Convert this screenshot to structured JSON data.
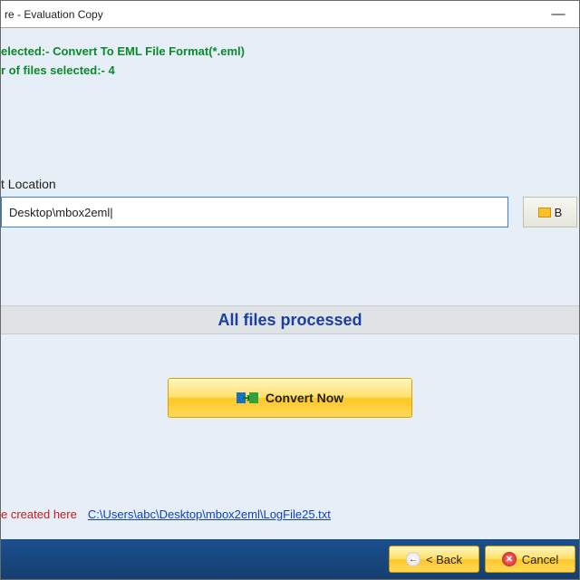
{
  "titlebar": {
    "title": "re - Evaluation Copy"
  },
  "info": {
    "format_line": "elected:- Convert To EML File Format(*.eml)",
    "files_line": "r of files selected:- 4"
  },
  "target": {
    "label": "t Location",
    "path_value": "Desktop\\mbox2eml|",
    "browse_label": "B"
  },
  "status": {
    "text": "All files processed"
  },
  "convert": {
    "label": "Convert Now"
  },
  "log": {
    "label": "e created here",
    "link": "C:\\Users\\abc\\Desktop\\mbox2eml\\LogFile25.txt"
  },
  "nav": {
    "back_label": "< Back",
    "cancel_label": "Cancel"
  }
}
